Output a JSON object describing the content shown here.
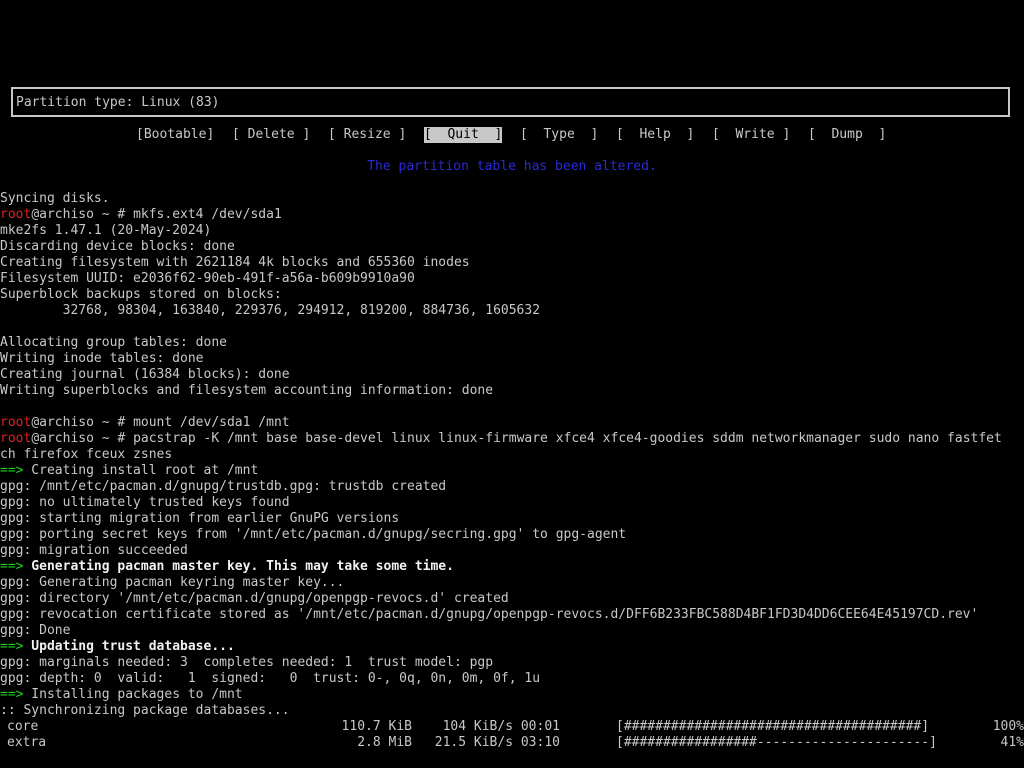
{
  "partition_box": {
    "text": "Partition type: Linux (83)"
  },
  "menu": [
    {
      "label": "[Bootable]",
      "selected": false
    },
    {
      "label": "[ Delete ]",
      "selected": false
    },
    {
      "label": "[ Resize ]",
      "selected": false
    },
    {
      "label": "[  Quit  ]",
      "selected": true
    },
    {
      "label": "[  Type  ]",
      "selected": false
    },
    {
      "label": "[  Help  ]",
      "selected": false
    },
    {
      "label": "[  Write ]",
      "selected": false
    },
    {
      "label": "[  Dump  ]",
      "selected": false
    }
  ],
  "status_message": "The partition table has been altered.",
  "terminal": {
    "prompt_user": "root",
    "prompt_rest": "@archiso ~ # ",
    "lines": [
      {
        "text": "Syncing disks."
      },
      {
        "cmd": "mkfs.ext4 /dev/sda1"
      },
      {
        "text": "mke2fs 1.47.1 (20-May-2024)"
      },
      {
        "text": "Discarding device blocks: done"
      },
      {
        "text": "Creating filesystem with 2621184 4k blocks and 655360 inodes"
      },
      {
        "text": "Filesystem UUID: e2036f62-90eb-491f-a56a-b609b9910a90"
      },
      {
        "text": "Superblock backups stored on blocks:"
      },
      {
        "text": "        32768, 98304, 163840, 229376, 294912, 819200, 884736, 1605632"
      },
      {
        "text": ""
      },
      {
        "text": "Allocating group tables: done"
      },
      {
        "text": "Writing inode tables: done"
      },
      {
        "text": "Creating journal (16384 blocks): done"
      },
      {
        "text": "Writing superblocks and filesystem accounting information: done"
      },
      {
        "text": ""
      },
      {
        "cmd": "mount /dev/sda1 /mnt"
      },
      {
        "cmd": "pacstrap -K /mnt base base-devel linux linux-firmware xfce4 xfce4-goodies sddm networkmanager sudo nano fastfet"
      },
      {
        "text": "ch firefox fceux zsnes"
      },
      {
        "arrow": "==>",
        "text": " Creating install root at /mnt",
        "bold": false
      },
      {
        "text": "gpg: /mnt/etc/pacman.d/gnupg/trustdb.gpg: trustdb created"
      },
      {
        "text": "gpg: no ultimately trusted keys found"
      },
      {
        "text": "gpg: starting migration from earlier GnuPG versions"
      },
      {
        "text": "gpg: porting secret keys from '/mnt/etc/pacman.d/gnupg/secring.gpg' to gpg-agent"
      },
      {
        "text": "gpg: migration succeeded"
      },
      {
        "arrow": "==>",
        "text": " Generating pacman master key. This may take some time.",
        "bold": true
      },
      {
        "text": "gpg: Generating pacman keyring master key..."
      },
      {
        "text": "gpg: directory '/mnt/etc/pacman.d/gnupg/openpgp-revocs.d' created"
      },
      {
        "text": "gpg: revocation certificate stored as '/mnt/etc/pacman.d/gnupg/openpgp-revocs.d/DFF6B233FBC588D4BF1FD3D4DD6CEE64E45197CD.rev'"
      },
      {
        "text": "gpg: Done"
      },
      {
        "arrow": "==>",
        "text": " Updating trust database...",
        "bold": true
      },
      {
        "text": "gpg: marginals needed: 3  completes needed: 1  trust model: pgp"
      },
      {
        "text": "gpg: depth: 0  valid:   1  signed:   0  trust: 0-, 0q, 0n, 0m, 0f, 1u"
      },
      {
        "arrow": "==>",
        "text": " Installing packages to /mnt",
        "bold": false
      },
      {
        "text": ":: Synchronizing package databases..."
      }
    ],
    "downloads": [
      {
        "name": "core",
        "size": "110.7 KiB",
        "rate": "104 KiB/s 00:01",
        "bar": "[######################################]",
        "pct": "100%"
      },
      {
        "name": "extra",
        "size": "2.8 MiB",
        "rate": "21.5 KiB/s 03:10",
        "bar": "[#################----------------------]",
        "pct": "41%"
      }
    ]
  },
  "colors": {
    "background": "#000000",
    "text": "#c8c8c8",
    "prompt_red": "#e02020",
    "arrow_green": "#20d020",
    "status_blue": "#2a2ad8"
  }
}
